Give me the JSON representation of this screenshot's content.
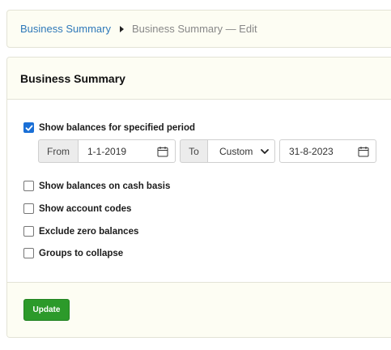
{
  "breadcrumb": {
    "root": "Business Summary",
    "current": "Business Summary — Edit"
  },
  "panel": {
    "title": "Business Summary"
  },
  "options": {
    "show_balances_period": {
      "label": "Show balances for specified period",
      "checked": true
    },
    "cash_basis": {
      "label": "Show balances on cash basis",
      "checked": false
    },
    "account_codes": {
      "label": "Show account codes",
      "checked": false
    },
    "exclude_zero": {
      "label": "Exclude zero balances",
      "checked": false
    },
    "groups_collapse": {
      "label": "Groups to collapse",
      "checked": false
    }
  },
  "period": {
    "from_label": "From",
    "from_value": "1-1-2019",
    "to_label": "To",
    "to_mode": "Custom",
    "to_value": "31-8-2023"
  },
  "footer": {
    "update_label": "Update"
  },
  "colors": {
    "accent": "#1a6fd6",
    "link": "#2f79b9",
    "update_button": "#2c9a2a",
    "panel_bg": "#fdfdf3"
  },
  "icons": {
    "date_picker": "calendar-icon",
    "select_arrow": "chevron-down-icon",
    "breadcrumb_separator": "caret-right-icon"
  }
}
